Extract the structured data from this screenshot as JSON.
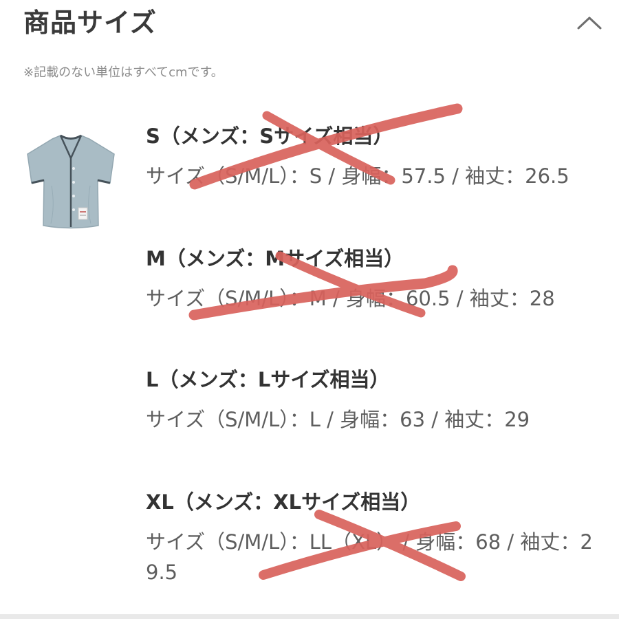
{
  "header": {
    "title": "商品サイズ",
    "toggle_icon": "chevron-up-icon"
  },
  "note": "※記載のない単位はすべてcmです。",
  "product": {
    "image_icon": "baseball-shirt-image"
  },
  "sizes": [
    {
      "title": "S（メンズ：Sサイズ相当）",
      "detail": "サイズ（S/M/L）：S / 身幅：57.5 / 袖丈：26.5"
    },
    {
      "title": "M（メンズ：Mサイズ相当）",
      "detail": "サイズ（S/M/L）：M / 身幅：60.5 / 袖丈：28"
    },
    {
      "title": "L（メンズ：Lサイズ相当）",
      "detail": "サイズ（S/M/L）：L / 身幅：63 / 袖丈：29"
    },
    {
      "title": "XL（メンズ：XLサイズ相当）",
      "detail": "サイズ（S/M/L）：LL（XL） / 身幅：68 / 袖丈：29.5"
    }
  ],
  "colors": {
    "strike": "#d9625c",
    "shirt": "#a9bcc5",
    "shirt_trim": "#46525a",
    "title_text": "#333333",
    "detail_text": "#5e5e5e",
    "note_text": "#8a8a8a"
  }
}
